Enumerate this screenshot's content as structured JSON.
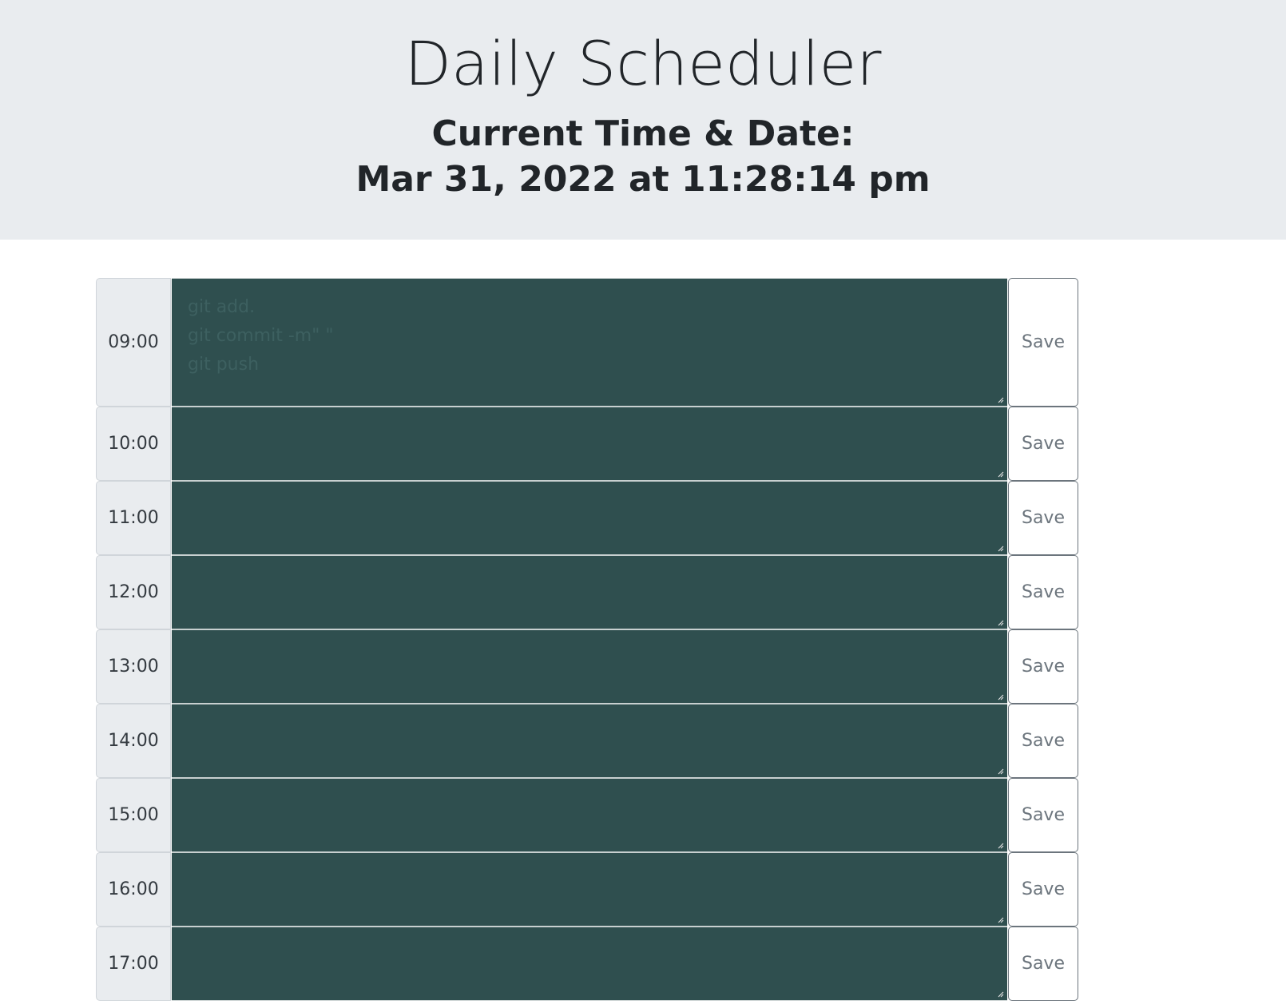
{
  "header": {
    "title": "Daily Scheduler",
    "time_label": "Current Time & Date:",
    "time_value": "Mar 31, 2022 at 11:28:14 pm"
  },
  "colors": {
    "header_bg": "#e9ecef",
    "past_block": "#2f4f4f",
    "save_text": "#6c757d"
  },
  "rows": [
    {
      "hour": "09:00",
      "text": [
        "git add.",
        "git commit -m\" \"",
        "git push"
      ],
      "save": "Save"
    },
    {
      "hour": "10:00",
      "text": [],
      "save": "Save"
    },
    {
      "hour": "11:00",
      "text": [],
      "save": "Save"
    },
    {
      "hour": "12:00",
      "text": [],
      "save": "Save"
    },
    {
      "hour": "13:00",
      "text": [],
      "save": "Save"
    },
    {
      "hour": "14:00",
      "text": [],
      "save": "Save"
    },
    {
      "hour": "15:00",
      "text": [],
      "save": "Save"
    },
    {
      "hour": "16:00",
      "text": [],
      "save": "Save"
    },
    {
      "hour": "17:00",
      "text": [],
      "save": "Save"
    }
  ]
}
